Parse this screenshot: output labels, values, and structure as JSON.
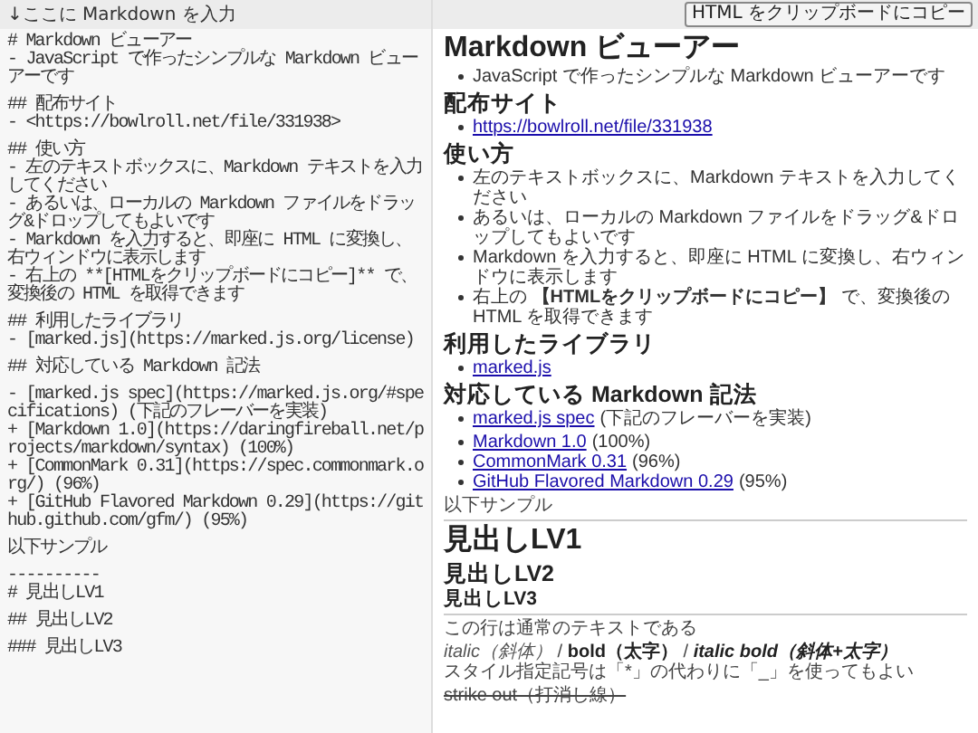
{
  "editor": {
    "label": "↓ここに Markdown を入力",
    "value": "# Markdown ビューアー\n- JavaScript で作ったシンプルな Markdown ビューアーです\n\n## 配布サイト\n- <https://bowlroll.net/file/331938>\n\n## 使い方\n- 左のテキストボックスに、Markdown テキストを入力してください\n- あるいは、ローカルの Markdown ファイルをドラッグ&ドロップしてもよいです\n- Markdown を入力すると、即座に HTML に変換し、右ウィンドウに表示します\n- 右上の **[HTMLをクリップボードにコピー]** で、変換後の HTML を取得できます\n\n## 利用したライブラリ\n- [marked.js](https://marked.js.org/license)\n\n## 対応している Markdown 記法\n\n- [marked.js spec](https://marked.js.org/#specifications) (下記のフレーバーを実装)\n+ [Markdown 1.0](https://daringfireball.net/projects/markdown/syntax) (100%)\n+ [CommonMark 0.31](https://spec.commonmark.org/) (96%)\n+ [GitHub Flavored Markdown 0.29](https://github.github.com/gfm/) (95%)\n\n以下サンプル\n\n----------\n# 見出しLV1\n\n## 見出しLV2\n\n### 見出しLV3"
  },
  "copy_button": "HTML をクリップボードにコピー",
  "preview": [
    {
      "kind": "h1",
      "text": "Markdown ビューアー"
    },
    {
      "kind": "list",
      "items": [
        {
          "text": "JavaScript で作ったシンプルな Markdown ビューアーです"
        }
      ]
    },
    {
      "kind": "h2",
      "text": "配布サイト"
    },
    {
      "kind": "list",
      "items": [
        {
          "link": "https://bowlroll.net/file/331938"
        }
      ]
    },
    {
      "kind": "h2",
      "text": "使い方"
    },
    {
      "kind": "list",
      "items": [
        {
          "text": "左のテキストボックスに、Markdown テキストを入力してください"
        },
        {
          "text": "あるいは、ローカルの Markdown ファイルをドラッグ&ドロップしてもよいです"
        },
        {
          "text": "Markdown を入力すると、即座に HTML に変換し、右ウィンドウに表示します"
        },
        {
          "text": "右上の **【HTMLをクリップボードにコピー】** で、変換後の HTML を取得できます"
        }
      ]
    },
    {
      "kind": "h2",
      "text": "利用したライブラリ"
    },
    {
      "kind": "list",
      "items": [
        {
          "link": "marked.js"
        }
      ]
    },
    {
      "kind": "h2",
      "text": "対応している Markdown 記法"
    },
    {
      "kind": "list",
      "items": [
        {
          "link": "marked.js spec",
          "text": "(下記のフレーバーを実装)"
        }
      ]
    },
    {
      "kind": "list",
      "items": [
        {
          "link": "Markdown 1.0",
          "text": "(100%)"
        },
        {
          "link": "CommonMark 0.31",
          "text": "(96%)"
        },
        {
          "link": "GitHub Flavored Markdown 0.29",
          "text": "(95%)"
        }
      ]
    },
    {
      "kind": "p",
      "lines": [
        "以下サンプル"
      ]
    },
    {
      "kind": "hr"
    },
    {
      "kind": "h1",
      "text": "見出しLV1"
    },
    {
      "kind": "h2",
      "text": "見出しLV2"
    },
    {
      "kind": "h3",
      "text": "見出しLV3"
    },
    {
      "kind": "hr"
    },
    {
      "kind": "p",
      "lines": [
        "この行は通常のテキストである"
      ]
    },
    {
      "kind": "styled",
      "lines": [
        [
          {
            "text": "italic（斜体）",
            "italic": true,
            "bold": false
          },
          {
            "text": " / ",
            "italic": false,
            "bold": false
          },
          {
            "text": "bold（太字）",
            "italic": false,
            "bold": true
          },
          {
            "text": " / ",
            "italic": false,
            "bold": false
          },
          {
            "text": "italic bold（斜体+太字）",
            "italic": true,
            "bold": true
          }
        ],
        [
          {
            "text": "スタイル指定記号は「*」の代わりに「_」を使ってもよい",
            "italic": false,
            "bold": false
          }
        ]
      ]
    },
    {
      "kind": "del",
      "lines": [
        "strike out（打消し線）"
      ]
    }
  ]
}
